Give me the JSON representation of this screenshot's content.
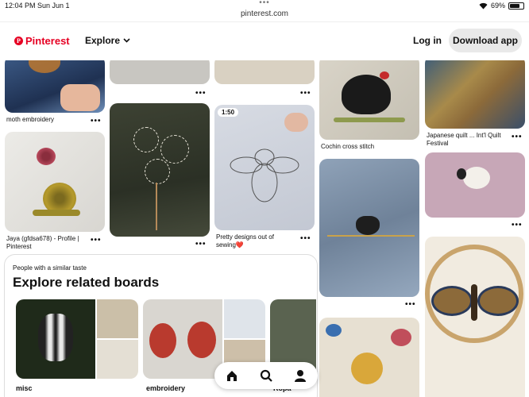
{
  "status_bar": {
    "time": "12:04 PM  Sun Jun 1",
    "url": "pinterest.com",
    "battery": "69%",
    "battery_level": 0.69
  },
  "header": {
    "brand": "Pinterest",
    "explore_label": "Explore",
    "login_label": "Log in",
    "download_label": "Download app"
  },
  "pins": {
    "col1": [
      {
        "caption": "moth embroidery"
      },
      {
        "caption": "Jaya (gfdsa678) - Profile |\nPinterest"
      }
    ],
    "col3": [
      {
        "duration": "1:50",
        "caption": "Pretty designs out of\nsewing❤️"
      }
    ],
    "col4": [
      {
        "caption": "Cochin cross stitch"
      }
    ],
    "col5": [
      {
        "caption": "Japanese quilt ... Int'l Quilt\nFestival"
      }
    ]
  },
  "related": {
    "subtitle": "People with a similar taste",
    "title": "Explore related boards",
    "boards": [
      {
        "name": "misc"
      },
      {
        "name": "embroidery"
      },
      {
        "name": "Ropa"
      }
    ]
  },
  "more_label": "•••",
  "bottom_nav": {
    "icons": [
      "home-icon",
      "search-icon",
      "profile-icon"
    ]
  },
  "colors": {
    "brand": "#e60023"
  }
}
